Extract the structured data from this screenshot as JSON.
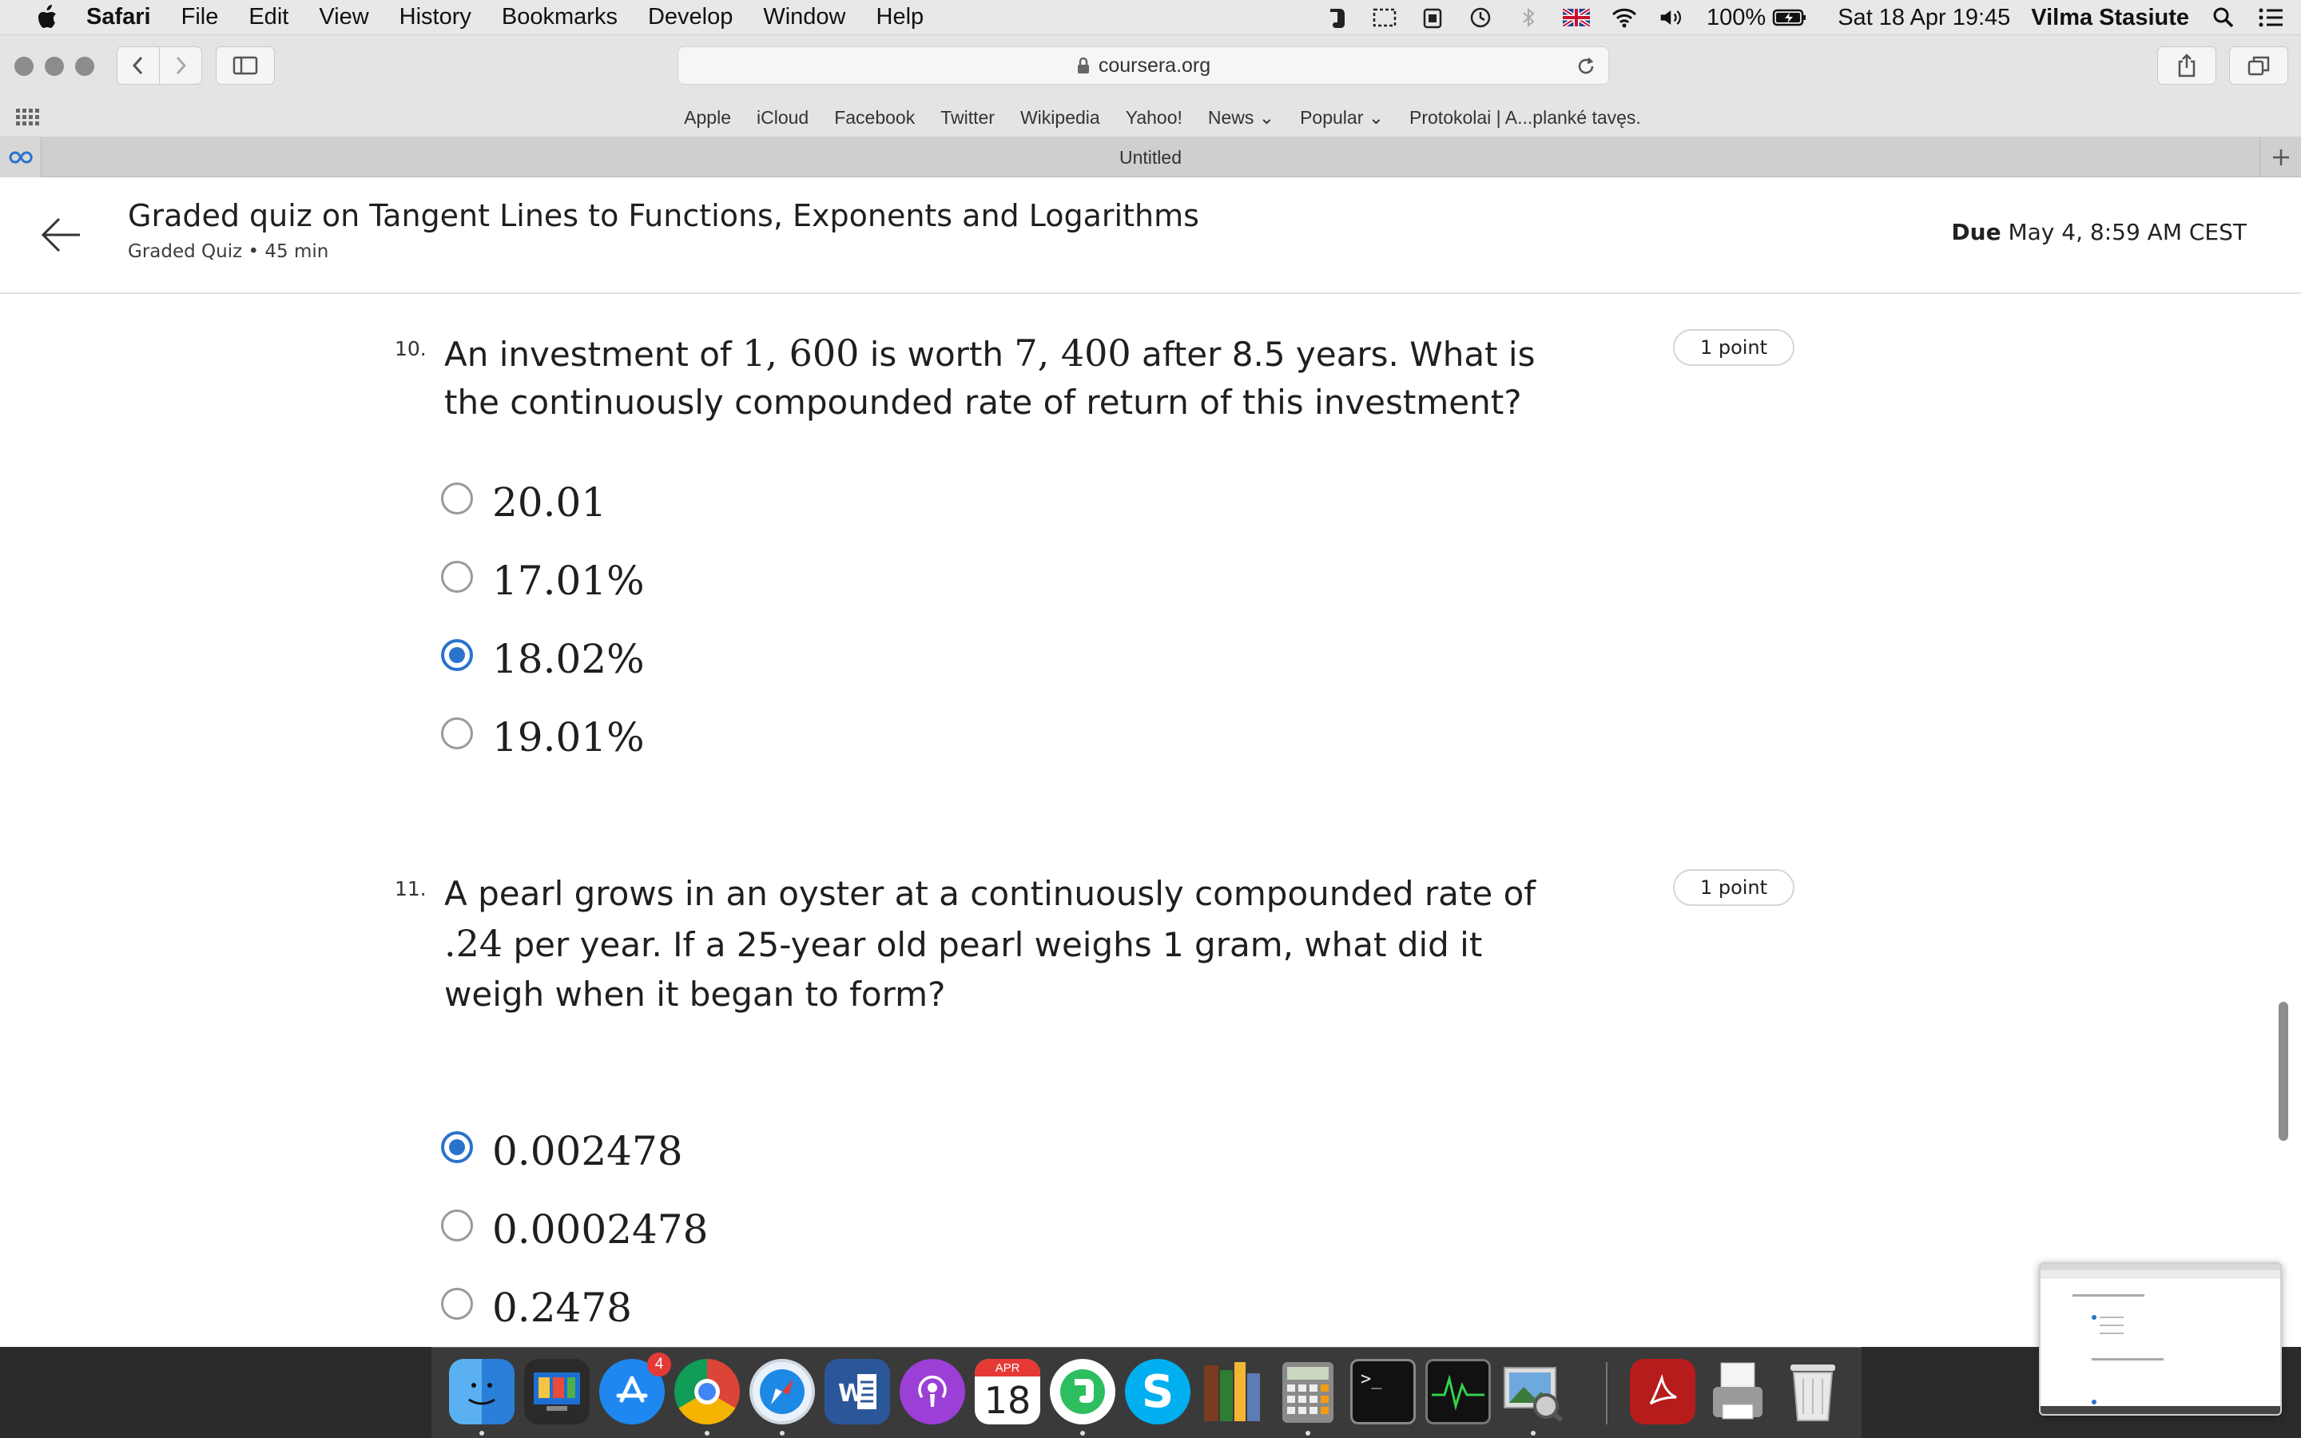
{
  "menubar": {
    "app_name": "Safari",
    "menus": [
      "File",
      "Edit",
      "View",
      "History",
      "Bookmarks",
      "Develop",
      "Window",
      "Help"
    ],
    "battery": "100%",
    "datetime": "Sat 18 Apr  19:45",
    "user": "Vilma Stasiute",
    "status_icons": [
      "evernote-icon",
      "screenshot-icon",
      "clipboard-icon",
      "time-machine-icon",
      "bluetooth-icon",
      "uk-flag-icon",
      "wifi-icon",
      "volume-icon",
      "battery-icon"
    ]
  },
  "toolbar": {
    "url": "coursera.org"
  },
  "favorites": [
    "Apple",
    "iCloud",
    "Facebook",
    "Twitter",
    "Wikipedia",
    "Yahoo!",
    "News ⌄",
    "Popular ⌄",
    "Protokolai | A...planké tavęs."
  ],
  "tab": {
    "title": "Untitled"
  },
  "header": {
    "title": "Graded quiz on Tangent Lines to Functions, Exponents and Logarithms",
    "subtitle": "Graded Quiz • 45 min",
    "due_label": "Due",
    "due_value": "May 4, 8:59 AM CEST"
  },
  "questions": [
    {
      "number": "10.",
      "points": "1 point",
      "text_a": "An investment of ",
      "math_a": "1, 600",
      "text_b": " is worth ",
      "math_b": "7, 400",
      "text_c": " after 8.5 years. What is the continuously compounded rate of return of this investment?",
      "options": [
        {
          "label": "20.01",
          "selected": false
        },
        {
          "label": "17.01%",
          "selected": false
        },
        {
          "label": "18.02%",
          "selected": true
        },
        {
          "label": "19.01%",
          "selected": false
        }
      ]
    },
    {
      "number": "11.",
      "points": "1 point",
      "text_a": "A pearl grows in an oyster at a continuously compounded rate of ",
      "math_a": ".24",
      "text_b": " per year. If a 25-year old pearl weighs 1 gram, what did it weigh when it began to form?",
      "options": [
        {
          "label": "0.002478",
          "selected": true
        },
        {
          "label": "0.0002478",
          "selected": false
        },
        {
          "label": "0.2478",
          "selected": false
        }
      ]
    }
  ],
  "dock": {
    "apps": [
      "finder-icon",
      "kodi-icon",
      "app-store-icon",
      "chrome-icon",
      "safari-icon",
      "word-icon",
      "podcasts-icon",
      "calendar-icon",
      "evernote-icon",
      "skype-icon",
      "calibre-icon",
      "books-icon",
      "calculator-icon",
      "terminal-icon",
      "activity-monitor-icon",
      "preview-icon",
      "acrobat-icon",
      "printer-icon",
      "trash-icon"
    ],
    "app_store_badge": "4",
    "calendar_month": "APR",
    "calendar_day": "18"
  }
}
